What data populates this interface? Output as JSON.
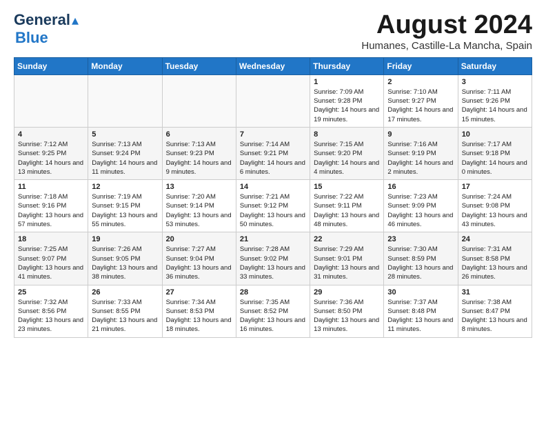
{
  "header": {
    "logo_general": "General",
    "logo_blue": "Blue",
    "title": "August 2024",
    "subtitle": "Humanes, Castille-La Mancha, Spain"
  },
  "weekdays": [
    "Sunday",
    "Monday",
    "Tuesday",
    "Wednesday",
    "Thursday",
    "Friday",
    "Saturday"
  ],
  "weeks": [
    [
      {
        "day": "",
        "info": ""
      },
      {
        "day": "",
        "info": ""
      },
      {
        "day": "",
        "info": ""
      },
      {
        "day": "",
        "info": ""
      },
      {
        "day": "1",
        "info": "Sunrise: 7:09 AM\nSunset: 9:28 PM\nDaylight: 14 hours and 19 minutes."
      },
      {
        "day": "2",
        "info": "Sunrise: 7:10 AM\nSunset: 9:27 PM\nDaylight: 14 hours and 17 minutes."
      },
      {
        "day": "3",
        "info": "Sunrise: 7:11 AM\nSunset: 9:26 PM\nDaylight: 14 hours and 15 minutes."
      }
    ],
    [
      {
        "day": "4",
        "info": "Sunrise: 7:12 AM\nSunset: 9:25 PM\nDaylight: 14 hours and 13 minutes."
      },
      {
        "day": "5",
        "info": "Sunrise: 7:13 AM\nSunset: 9:24 PM\nDaylight: 14 hours and 11 minutes."
      },
      {
        "day": "6",
        "info": "Sunrise: 7:13 AM\nSunset: 9:23 PM\nDaylight: 14 hours and 9 minutes."
      },
      {
        "day": "7",
        "info": "Sunrise: 7:14 AM\nSunset: 9:21 PM\nDaylight: 14 hours and 6 minutes."
      },
      {
        "day": "8",
        "info": "Sunrise: 7:15 AM\nSunset: 9:20 PM\nDaylight: 14 hours and 4 minutes."
      },
      {
        "day": "9",
        "info": "Sunrise: 7:16 AM\nSunset: 9:19 PM\nDaylight: 14 hours and 2 minutes."
      },
      {
        "day": "10",
        "info": "Sunrise: 7:17 AM\nSunset: 9:18 PM\nDaylight: 14 hours and 0 minutes."
      }
    ],
    [
      {
        "day": "11",
        "info": "Sunrise: 7:18 AM\nSunset: 9:16 PM\nDaylight: 13 hours and 57 minutes."
      },
      {
        "day": "12",
        "info": "Sunrise: 7:19 AM\nSunset: 9:15 PM\nDaylight: 13 hours and 55 minutes."
      },
      {
        "day": "13",
        "info": "Sunrise: 7:20 AM\nSunset: 9:14 PM\nDaylight: 13 hours and 53 minutes."
      },
      {
        "day": "14",
        "info": "Sunrise: 7:21 AM\nSunset: 9:12 PM\nDaylight: 13 hours and 50 minutes."
      },
      {
        "day": "15",
        "info": "Sunrise: 7:22 AM\nSunset: 9:11 PM\nDaylight: 13 hours and 48 minutes."
      },
      {
        "day": "16",
        "info": "Sunrise: 7:23 AM\nSunset: 9:09 PM\nDaylight: 13 hours and 46 minutes."
      },
      {
        "day": "17",
        "info": "Sunrise: 7:24 AM\nSunset: 9:08 PM\nDaylight: 13 hours and 43 minutes."
      }
    ],
    [
      {
        "day": "18",
        "info": "Sunrise: 7:25 AM\nSunset: 9:07 PM\nDaylight: 13 hours and 41 minutes."
      },
      {
        "day": "19",
        "info": "Sunrise: 7:26 AM\nSunset: 9:05 PM\nDaylight: 13 hours and 38 minutes."
      },
      {
        "day": "20",
        "info": "Sunrise: 7:27 AM\nSunset: 9:04 PM\nDaylight: 13 hours and 36 minutes."
      },
      {
        "day": "21",
        "info": "Sunrise: 7:28 AM\nSunset: 9:02 PM\nDaylight: 13 hours and 33 minutes."
      },
      {
        "day": "22",
        "info": "Sunrise: 7:29 AM\nSunset: 9:01 PM\nDaylight: 13 hours and 31 minutes."
      },
      {
        "day": "23",
        "info": "Sunrise: 7:30 AM\nSunset: 8:59 PM\nDaylight: 13 hours and 28 minutes."
      },
      {
        "day": "24",
        "info": "Sunrise: 7:31 AM\nSunset: 8:58 PM\nDaylight: 13 hours and 26 minutes."
      }
    ],
    [
      {
        "day": "25",
        "info": "Sunrise: 7:32 AM\nSunset: 8:56 PM\nDaylight: 13 hours and 23 minutes."
      },
      {
        "day": "26",
        "info": "Sunrise: 7:33 AM\nSunset: 8:55 PM\nDaylight: 13 hours and 21 minutes."
      },
      {
        "day": "27",
        "info": "Sunrise: 7:34 AM\nSunset: 8:53 PM\nDaylight: 13 hours and 18 minutes."
      },
      {
        "day": "28",
        "info": "Sunrise: 7:35 AM\nSunset: 8:52 PM\nDaylight: 13 hours and 16 minutes."
      },
      {
        "day": "29",
        "info": "Sunrise: 7:36 AM\nSunset: 8:50 PM\nDaylight: 13 hours and 13 minutes."
      },
      {
        "day": "30",
        "info": "Sunrise: 7:37 AM\nSunset: 8:48 PM\nDaylight: 13 hours and 11 minutes."
      },
      {
        "day": "31",
        "info": "Sunrise: 7:38 AM\nSunset: 8:47 PM\nDaylight: 13 hours and 8 minutes."
      }
    ]
  ]
}
